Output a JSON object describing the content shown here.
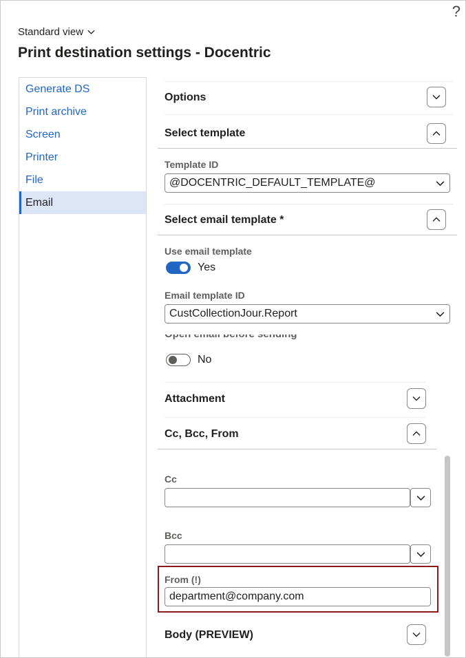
{
  "header": {
    "help": "?",
    "view": "Standard view",
    "title": "Print destination settings - Docentric"
  },
  "nav": {
    "items": [
      "Generate DS",
      "Print archive",
      "Screen",
      "Printer",
      "File",
      "Email"
    ],
    "selected": "Email"
  },
  "sections": {
    "options": "Options",
    "select_template": "Select template",
    "select_email_template": "Select email template *",
    "attachment": "Attachment",
    "cc_bcc_from": "Cc, Bcc, From",
    "body": "Body (PREVIEW)"
  },
  "fields": {
    "template_id_label": "Template ID",
    "template_id_value": "@DOCENTRIC_DEFAULT_TEMPLATE@",
    "use_email_template_label": "Use email template",
    "use_email_template_value": "Yes",
    "email_template_id_label": "Email template ID",
    "email_template_id_value": "CustCollectionJour.Report",
    "open_email_label": "Open email before sending",
    "open_email_value": "No",
    "cc_label": "Cc",
    "cc_value": "",
    "bcc_label": "Bcc",
    "bcc_value": "",
    "from_label": "From (!)",
    "from_value": "department@company.com"
  },
  "colors": {
    "accent": "#2266c4",
    "highlight_border": "#8b1a1a"
  }
}
